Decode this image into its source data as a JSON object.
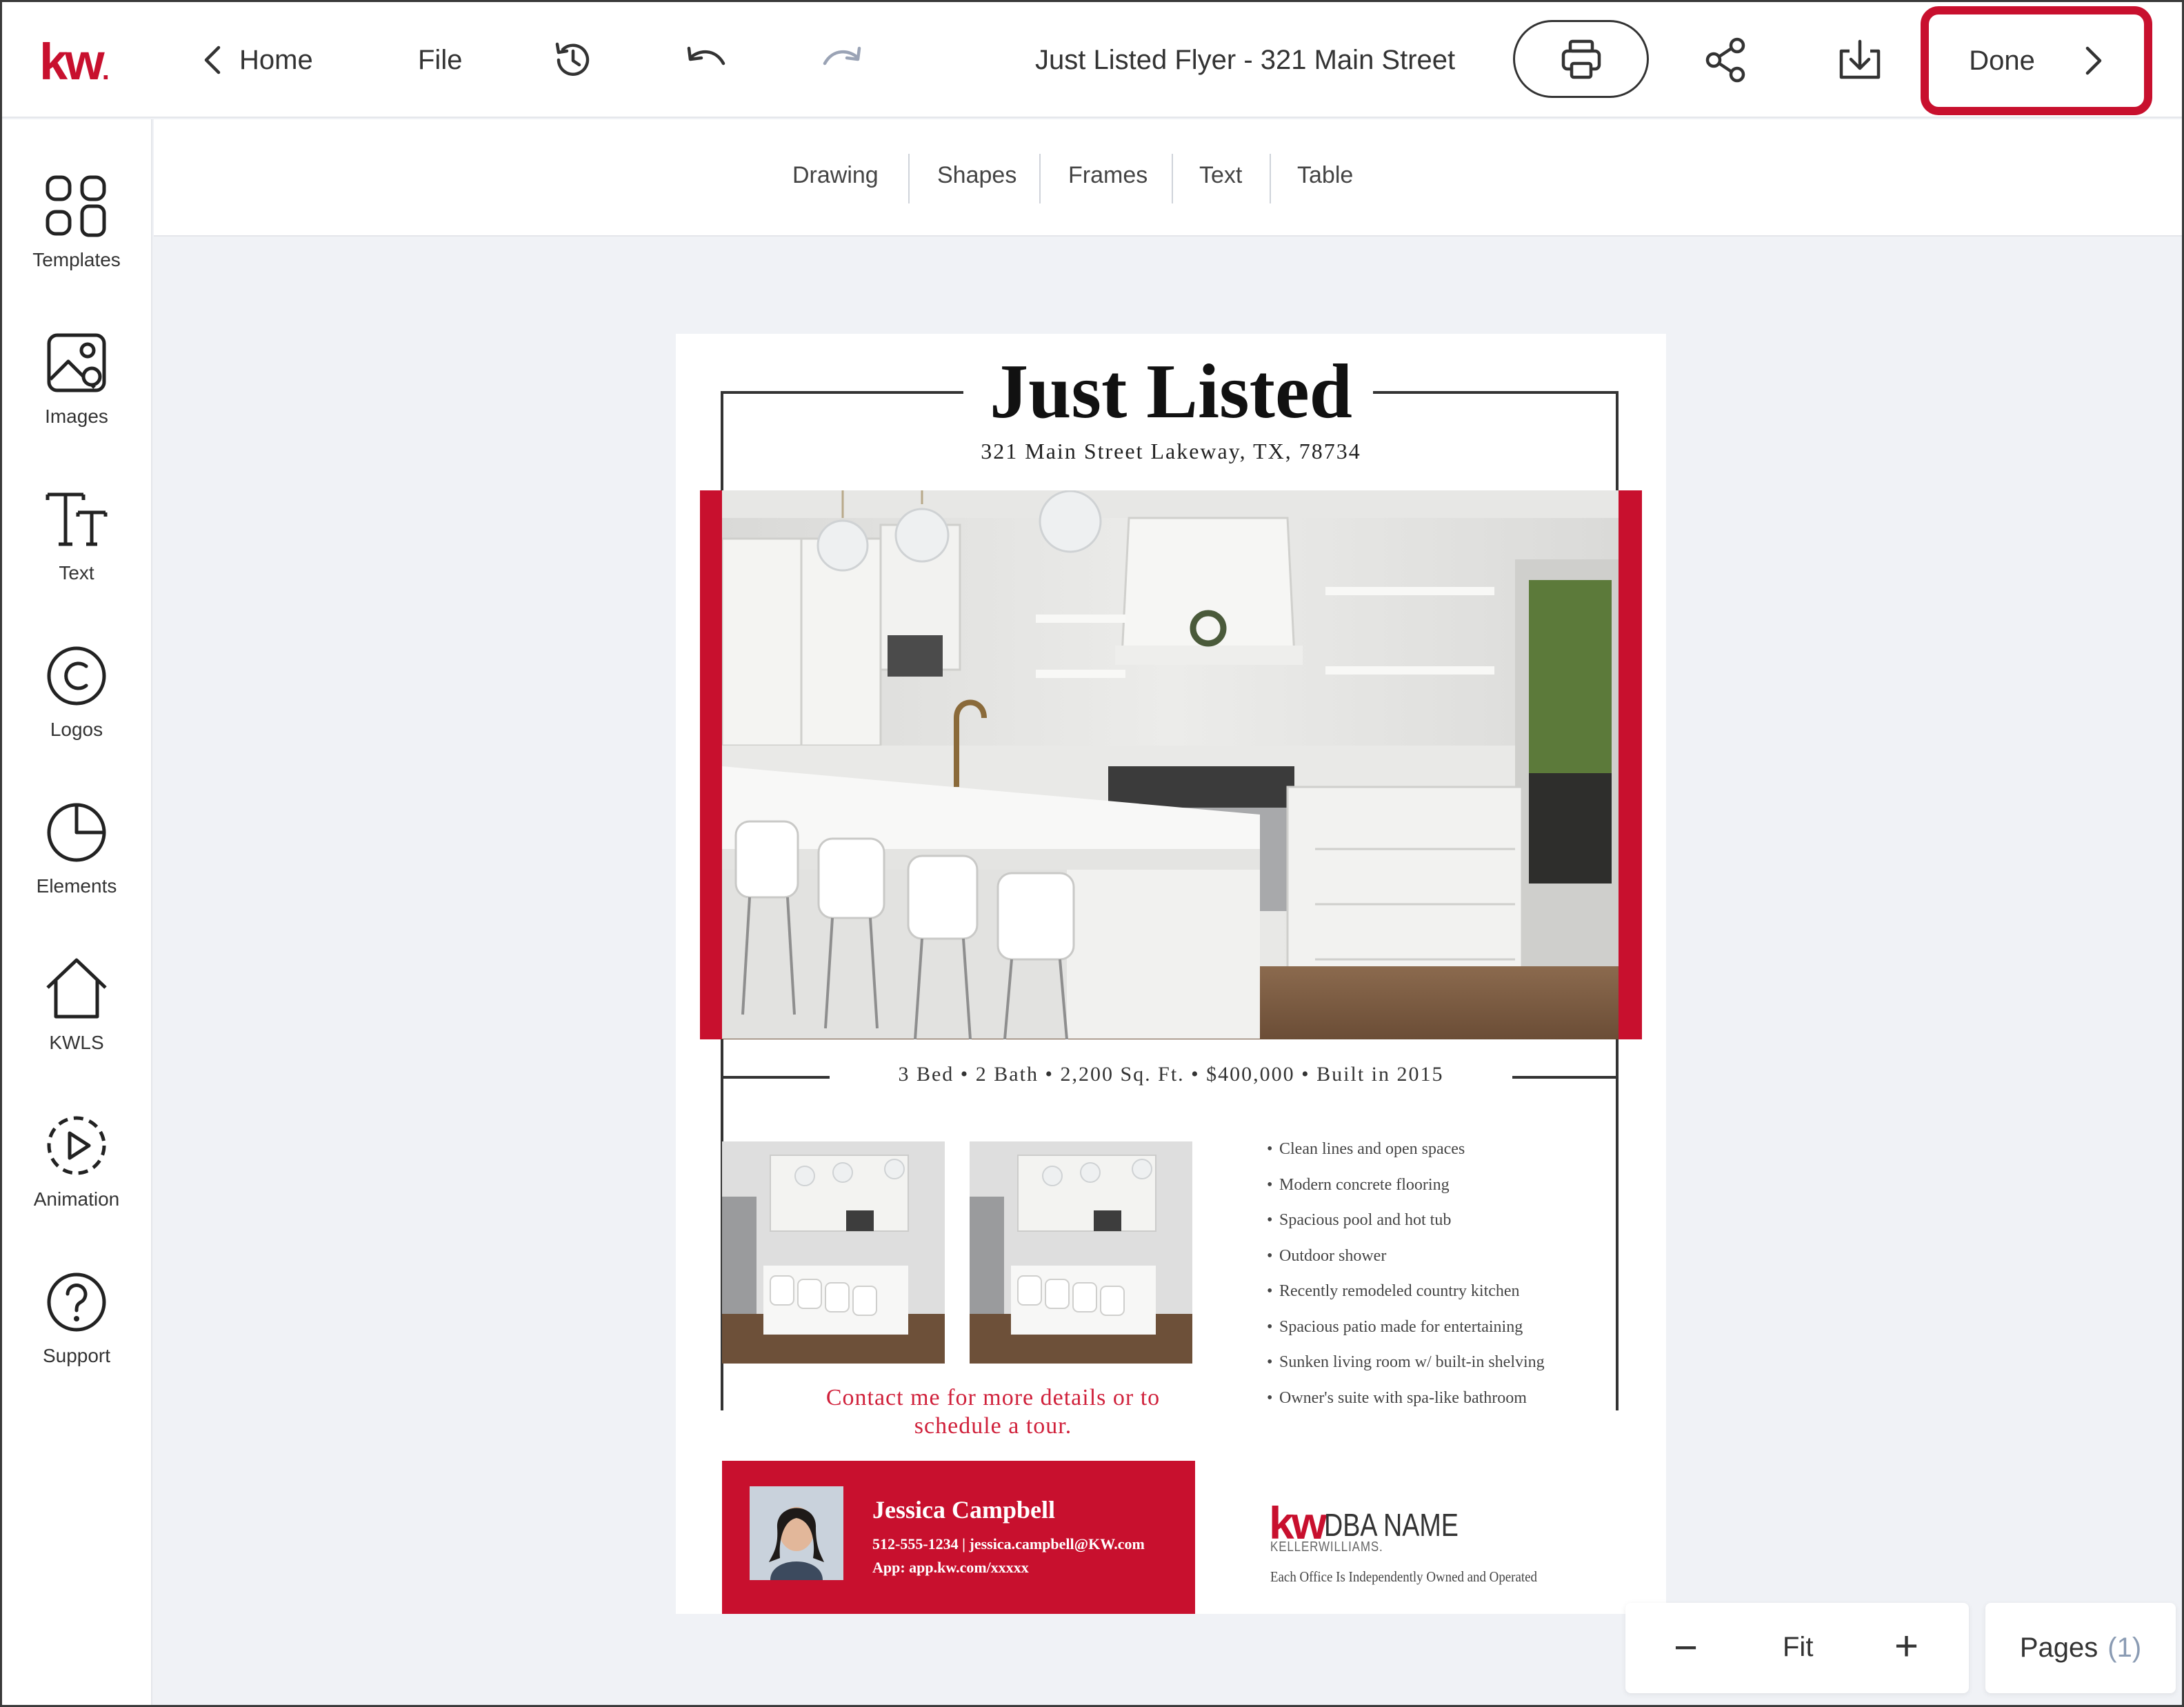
{
  "app": {
    "logo": "kw",
    "brand_color": "#c8102e"
  },
  "topbar": {
    "home_label": "Home",
    "file_label": "File",
    "doc_title": "Just Listed Flyer - 321 Main Street",
    "done_label": "Done",
    "icons": [
      "chevron-left-icon",
      "history-icon",
      "undo-icon",
      "redo-icon",
      "print-icon",
      "share-icon",
      "download-icon",
      "chevron-right-icon"
    ]
  },
  "sidebar": {
    "items": [
      {
        "label": "Templates",
        "icon": "grid-icon"
      },
      {
        "label": "Images",
        "icon": "image-icon"
      },
      {
        "label": "Text",
        "icon": "text-icon"
      },
      {
        "label": "Logos",
        "icon": "copyright-icon"
      },
      {
        "label": "Elements",
        "icon": "pie-icon"
      },
      {
        "label": "KWLS",
        "icon": "house-icon"
      },
      {
        "label": "Animation",
        "icon": "play-circle-icon"
      },
      {
        "label": "Support",
        "icon": "help-icon"
      }
    ]
  },
  "tools": {
    "tabs": [
      "Drawing",
      "Shapes",
      "Frames",
      "Text",
      "Table"
    ]
  },
  "flyer": {
    "title": "Just Listed",
    "address": "321 Main Street Lakeway, TX, 78734",
    "stats": "3 Bed • 2 Bath • 2,200 Sq. Ft. • $400,000 • Built in 2015",
    "features": [
      "Clean lines and open spaces",
      "Modern concrete flooring",
      "Spacious pool and hot tub",
      "Outdoor shower",
      "Recently remodeled country kitchen",
      "Spacious patio made for entertaining",
      "Sunken living room w/ built-in shelving",
      "Owner's suite with spa-like bathroom"
    ],
    "cta_line1": "Contact me for more details or to",
    "cta_line2": "schedule a tour.",
    "agent": {
      "name": "Jessica Campbell",
      "contact": "512-555-1234 | jessica.campbell@KW.com",
      "app": "App: app.kw.com/xxxxx"
    },
    "brand": {
      "kw": "kw",
      "dba": "DBA NAME",
      "company": "KELLERWILLIAMS.",
      "note": "Each Office Is Independently Owned and Operated"
    }
  },
  "zoom": {
    "minus": "−",
    "fit_label": "Fit",
    "plus": "+"
  },
  "pages": {
    "label": "Pages",
    "count": "(1)"
  }
}
